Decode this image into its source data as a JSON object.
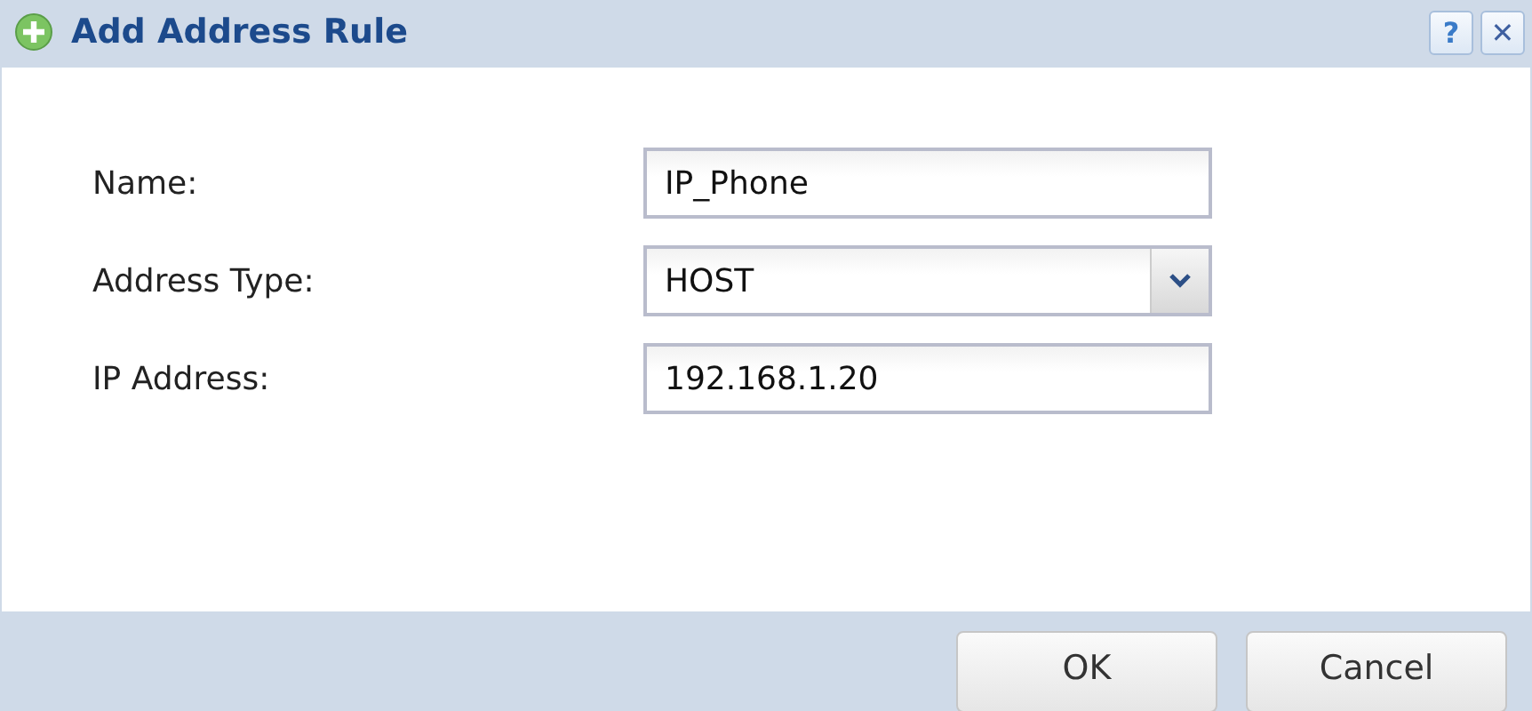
{
  "window": {
    "title": "Add Address Rule",
    "help": "?",
    "close": "✕"
  },
  "fields": [
    {
      "label": "Name:",
      "kind": "text",
      "value": "IP_Phone"
    },
    {
      "label": "Address Type:",
      "kind": "select",
      "value": "HOST"
    },
    {
      "label": "IP Address:",
      "kind": "text",
      "value": "192.168.1.20"
    }
  ],
  "buttons": [
    "OK",
    "Cancel"
  ]
}
